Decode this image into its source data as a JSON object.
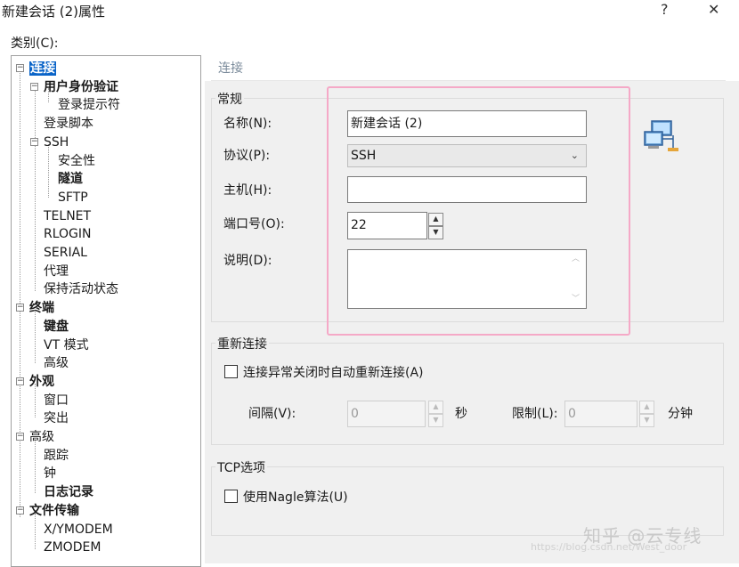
{
  "window": {
    "title": "新建会话 (2)属性",
    "help": "?",
    "close": "✕"
  },
  "category_label": "类别(C):",
  "tree": [
    {
      "label": "连接",
      "level": 0,
      "exp": "⊟"
    },
    {
      "label": "用户身份验证",
      "level": 1,
      "exp": "⊟"
    },
    {
      "label": "登录提示符",
      "level": 2
    },
    {
      "label": "登录脚本",
      "level": 1
    },
    {
      "label": "SSH",
      "level": 1,
      "exp": "⊟"
    },
    {
      "label": "安全性",
      "level": 2
    },
    {
      "label": "隧道",
      "level": 2
    },
    {
      "label": "SFTP",
      "level": 2
    },
    {
      "label": "TELNET",
      "level": 1
    },
    {
      "label": "RLOGIN",
      "level": 1
    },
    {
      "label": "SERIAL",
      "level": 1
    },
    {
      "label": "代理",
      "level": 1
    },
    {
      "label": "保持活动状态",
      "level": 1
    },
    {
      "label": "终端",
      "level": 0,
      "exp": "⊟"
    },
    {
      "label": "键盘",
      "level": 1
    },
    {
      "label": "VT 模式",
      "level": 1
    },
    {
      "label": "高级",
      "level": 1
    },
    {
      "label": "外观",
      "level": 0,
      "exp": "⊟"
    },
    {
      "label": "窗口",
      "level": 1
    },
    {
      "label": "突出",
      "level": 1
    },
    {
      "label": "高级",
      "level": 0,
      "exp": "⊟"
    },
    {
      "label": "跟踪",
      "level": 1
    },
    {
      "label": "钟",
      "level": 1
    },
    {
      "label": "日志记录",
      "level": 1
    },
    {
      "label": "文件传输",
      "level": 0,
      "exp": "⊟"
    },
    {
      "label": "X/YMODEM",
      "level": 1
    },
    {
      "label": "ZMODEM",
      "level": 1
    }
  ],
  "panel_title": "连接",
  "general": {
    "group": "常规",
    "name_label": "名称(N):",
    "name_value": "新建会话 (2)",
    "protocol_label": "协议(P):",
    "protocol_value": "SSH",
    "host_label": "主机(H):",
    "host_value": "",
    "port_label": "端口号(O):",
    "port_value": "22",
    "desc_label": "说明(D):",
    "desc_value": ""
  },
  "reconnect": {
    "group": "重新连接",
    "checkbox": "连接异常关闭时自动重新连接(A)",
    "interval_label": "间隔(V):",
    "interval_value": "0",
    "interval_unit": "秒",
    "limit_label": "限制(L):",
    "limit_value": "0",
    "limit_unit": "分钟"
  },
  "tcp": {
    "group": "TCP选项",
    "checkbox": "使用Nagle算法(U)"
  },
  "watermark": {
    "main": "知乎 @云专线",
    "sub": "https://blog.csdn.net/West_door"
  },
  "colors": {
    "selection": "#0a64c8",
    "highlight_box": "#f5a9c7",
    "panel": "#f0f0f0"
  }
}
